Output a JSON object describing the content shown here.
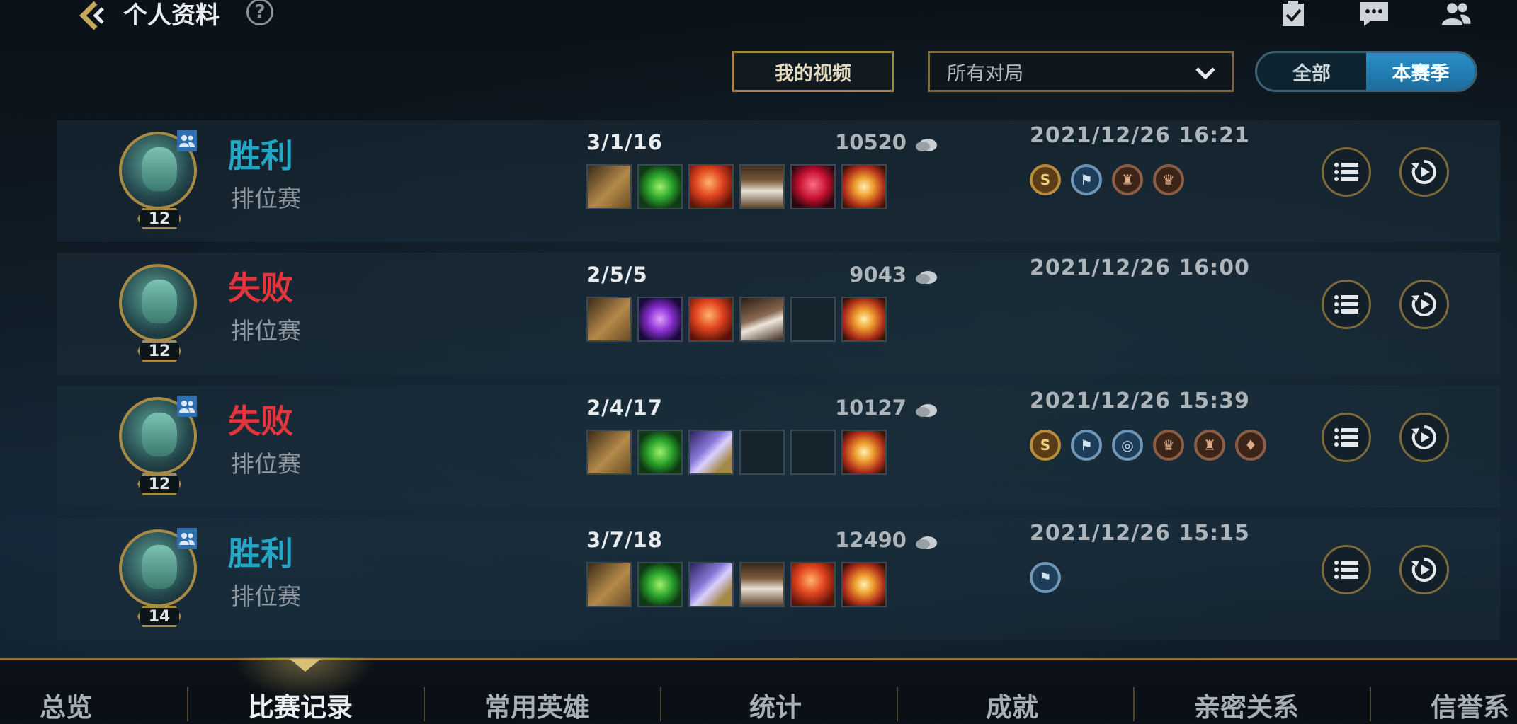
{
  "header": {
    "title": "个人资料",
    "help": "?"
  },
  "toolbar": {
    "video_button": "我的视频",
    "filter_value": "所有对局",
    "segment": [
      "全部",
      "本赛季"
    ],
    "segment_selected": "本赛季"
  },
  "matches": [
    {
      "result": "胜利",
      "outcome": "win",
      "mode": "排位赛",
      "level": "12",
      "party": true,
      "kda": "3/1/16",
      "gold": "10520",
      "date": "2021/12/26 16:21",
      "items": [
        "gauntlet",
        "green-orb",
        "red-orb",
        "boots-fist",
        "ruby-crystal",
        "trinket-star"
      ],
      "badges": [
        "gold-s",
        "blue-flag",
        "bronze-tower",
        "bronze-crest"
      ]
    },
    {
      "result": "失败",
      "outcome": "lose",
      "mode": "排位赛",
      "level": "12",
      "party": false,
      "kda": "2/5/5",
      "gold": "9043",
      "date": "2021/12/26 16:00",
      "items": [
        "gauntlet",
        "purple-gem",
        "red-orb",
        "boots-plate",
        "empty",
        "trinket-star"
      ],
      "badges": []
    },
    {
      "result": "失败",
      "outcome": "lose",
      "mode": "排位赛",
      "level": "12",
      "party": true,
      "kda": "2/4/17",
      "gold": "10127",
      "date": "2021/12/26 15:39",
      "items": [
        "gauntlet",
        "green-orb",
        "purple-tome",
        "empty",
        "empty",
        "trinket-star"
      ],
      "badges": [
        "gold-s",
        "blue-flag",
        "blue-vision",
        "bronze-crest",
        "bronze-tower",
        "bronze-drop"
      ]
    },
    {
      "result": "胜利",
      "outcome": "win",
      "mode": "排位赛",
      "level": "14",
      "party": true,
      "kda": "3/7/18",
      "gold": "12490",
      "date": "2021/12/26 15:15",
      "items": [
        "gauntlet",
        "green-orb",
        "purple-tome",
        "boots-fist",
        "red-orb",
        "trinket-star"
      ],
      "badges": [
        "blue-flag"
      ]
    }
  ],
  "tabs": [
    "总览",
    "比赛记录",
    "常用英雄",
    "统计",
    "成就",
    "亲密关系",
    "信誉系"
  ],
  "active_tab": "比赛记录",
  "colors": {
    "win": "#22a7c7",
    "lose": "#e2363c",
    "gold_border": "#a88a45",
    "accent": "#2a8fc7"
  }
}
